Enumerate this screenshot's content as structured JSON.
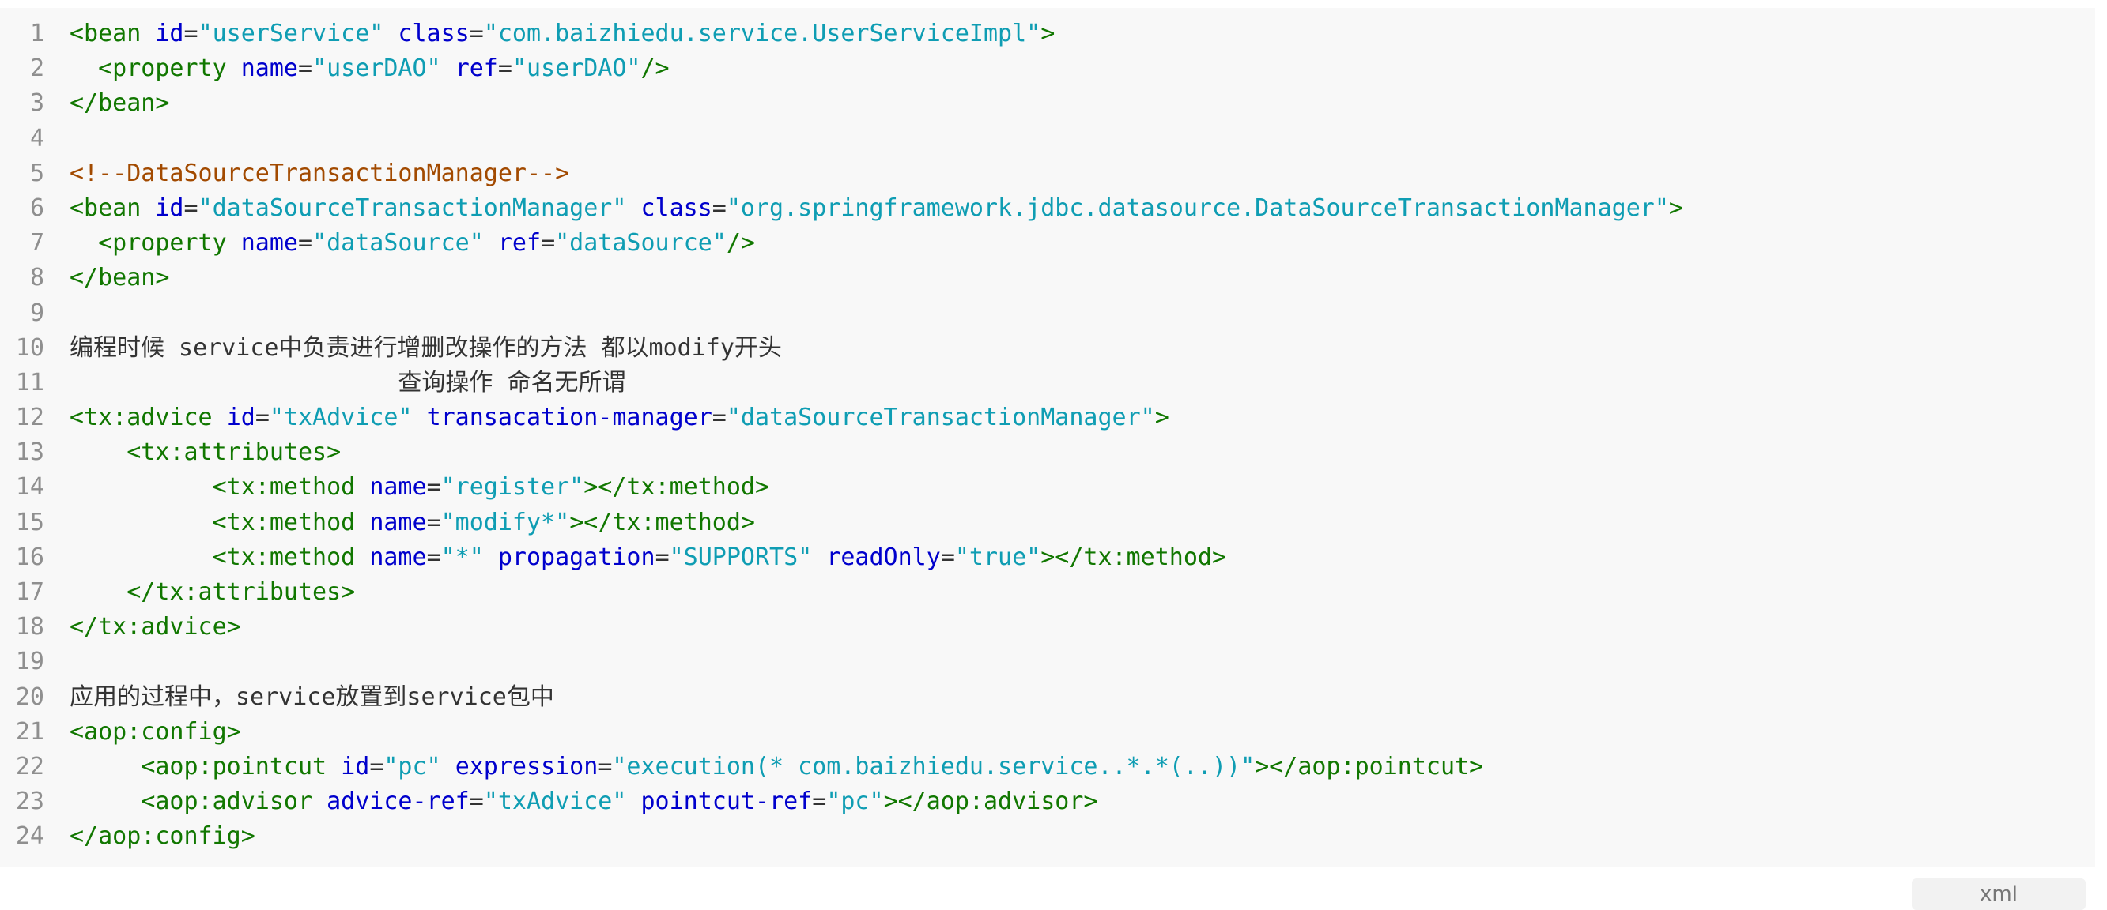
{
  "code_block": {
    "language": "xml",
    "colors": {
      "background": "#f8f8f8",
      "line_number": "#8f8f8f",
      "tag": "#117700",
      "attribute": "#0000cc",
      "string": "#0f9db3",
      "comment": "#a24a00",
      "text": "#333333"
    },
    "lines": [
      [
        {
          "t": "tag",
          "v": "<bean "
        },
        {
          "t": "attr",
          "v": "id"
        },
        {
          "t": "txt",
          "v": "="
        },
        {
          "t": "str",
          "v": "\"userService\""
        },
        {
          "t": "txt",
          "v": " "
        },
        {
          "t": "attr",
          "v": "class"
        },
        {
          "t": "txt",
          "v": "="
        },
        {
          "t": "str",
          "v": "\"com.baizhiedu.service.UserServiceImpl\""
        },
        {
          "t": "tag",
          "v": ">"
        }
      ],
      [
        {
          "t": "txt",
          "v": "  "
        },
        {
          "t": "tag",
          "v": "<property "
        },
        {
          "t": "attr",
          "v": "name"
        },
        {
          "t": "txt",
          "v": "="
        },
        {
          "t": "str",
          "v": "\"userDAO\""
        },
        {
          "t": "txt",
          "v": " "
        },
        {
          "t": "attr",
          "v": "ref"
        },
        {
          "t": "txt",
          "v": "="
        },
        {
          "t": "str",
          "v": "\"userDAO\""
        },
        {
          "t": "tag",
          "v": "/>"
        }
      ],
      [
        {
          "t": "tag",
          "v": "</bean>"
        }
      ],
      [],
      [
        {
          "t": "cmt",
          "v": "<!--DataSourceTransactionManager-->"
        }
      ],
      [
        {
          "t": "tag",
          "v": "<bean "
        },
        {
          "t": "attr",
          "v": "id"
        },
        {
          "t": "txt",
          "v": "="
        },
        {
          "t": "str",
          "v": "\"dataSourceTransactionManager\""
        },
        {
          "t": "txt",
          "v": " "
        },
        {
          "t": "attr",
          "v": "class"
        },
        {
          "t": "txt",
          "v": "="
        },
        {
          "t": "str",
          "v": "\"org.springframework.jdbc.datasource.DataSourceTransactionManager\""
        },
        {
          "t": "tag",
          "v": ">"
        }
      ],
      [
        {
          "t": "txt",
          "v": "  "
        },
        {
          "t": "tag",
          "v": "<property "
        },
        {
          "t": "attr",
          "v": "name"
        },
        {
          "t": "txt",
          "v": "="
        },
        {
          "t": "str",
          "v": "\"dataSource\""
        },
        {
          "t": "txt",
          "v": " "
        },
        {
          "t": "attr",
          "v": "ref"
        },
        {
          "t": "txt",
          "v": "="
        },
        {
          "t": "str",
          "v": "\"dataSource\""
        },
        {
          "t": "tag",
          "v": "/>"
        }
      ],
      [
        {
          "t": "tag",
          "v": "</bean>"
        }
      ],
      [],
      [
        {
          "t": "txt",
          "v": "编程时候 service中负责进行增删改操作的方法 都以modify开头"
        }
      ],
      [
        {
          "t": "txt",
          "v": "                       查询操作 命名无所谓"
        }
      ],
      [
        {
          "t": "tag",
          "v": "<tx:advice "
        },
        {
          "t": "attr",
          "v": "id"
        },
        {
          "t": "txt",
          "v": "="
        },
        {
          "t": "str",
          "v": "\"txAdvice\""
        },
        {
          "t": "txt",
          "v": " "
        },
        {
          "t": "attr",
          "v": "transacation-manager"
        },
        {
          "t": "txt",
          "v": "="
        },
        {
          "t": "str",
          "v": "\"dataSourceTransactionManager\""
        },
        {
          "t": "tag",
          "v": ">"
        }
      ],
      [
        {
          "t": "txt",
          "v": "    "
        },
        {
          "t": "tag",
          "v": "<tx:attributes>"
        }
      ],
      [
        {
          "t": "txt",
          "v": "          "
        },
        {
          "t": "tag",
          "v": "<tx:method "
        },
        {
          "t": "attr",
          "v": "name"
        },
        {
          "t": "txt",
          "v": "="
        },
        {
          "t": "str",
          "v": "\"register\""
        },
        {
          "t": "tag",
          "v": "></tx:method>"
        }
      ],
      [
        {
          "t": "txt",
          "v": "          "
        },
        {
          "t": "tag",
          "v": "<tx:method "
        },
        {
          "t": "attr",
          "v": "name"
        },
        {
          "t": "txt",
          "v": "="
        },
        {
          "t": "str",
          "v": "\"modify*\""
        },
        {
          "t": "tag",
          "v": "></tx:method>"
        }
      ],
      [
        {
          "t": "txt",
          "v": "          "
        },
        {
          "t": "tag",
          "v": "<tx:method "
        },
        {
          "t": "attr",
          "v": "name"
        },
        {
          "t": "txt",
          "v": "="
        },
        {
          "t": "str",
          "v": "\"*\""
        },
        {
          "t": "txt",
          "v": " "
        },
        {
          "t": "attr",
          "v": "propagation"
        },
        {
          "t": "txt",
          "v": "="
        },
        {
          "t": "str",
          "v": "\"SUPPORTS\""
        },
        {
          "t": "txt",
          "v": " "
        },
        {
          "t": "attr",
          "v": "readOnly"
        },
        {
          "t": "txt",
          "v": "="
        },
        {
          "t": "str",
          "v": "\"true\""
        },
        {
          "t": "tag",
          "v": "></tx:method>"
        }
      ],
      [
        {
          "t": "txt",
          "v": "    "
        },
        {
          "t": "tag",
          "v": "</tx:attributes>"
        }
      ],
      [
        {
          "t": "tag",
          "v": "</tx:advice>"
        }
      ],
      [],
      [
        {
          "t": "txt",
          "v": "应用的过程中，service放置到service包中"
        }
      ],
      [
        {
          "t": "tag",
          "v": "<aop:config>"
        }
      ],
      [
        {
          "t": "txt",
          "v": "     "
        },
        {
          "t": "tag",
          "v": "<aop:pointcut "
        },
        {
          "t": "attr",
          "v": "id"
        },
        {
          "t": "txt",
          "v": "="
        },
        {
          "t": "str",
          "v": "\"pc\""
        },
        {
          "t": "txt",
          "v": " "
        },
        {
          "t": "attr",
          "v": "expression"
        },
        {
          "t": "txt",
          "v": "="
        },
        {
          "t": "str",
          "v": "\"execution(* com.baizhiedu.service..*.*(..))\""
        },
        {
          "t": "tag",
          "v": "></aop:pointcut>"
        }
      ],
      [
        {
          "t": "txt",
          "v": "     "
        },
        {
          "t": "tag",
          "v": "<aop:advisor "
        },
        {
          "t": "attr",
          "v": "advice-ref"
        },
        {
          "t": "txt",
          "v": "="
        },
        {
          "t": "str",
          "v": "\"txAdvice\""
        },
        {
          "t": "txt",
          "v": " "
        },
        {
          "t": "attr",
          "v": "pointcut-ref"
        },
        {
          "t": "txt",
          "v": "="
        },
        {
          "t": "str",
          "v": "\"pc\""
        },
        {
          "t": "tag",
          "v": "></aop:advisor>"
        }
      ],
      [
        {
          "t": "tag",
          "v": "</aop:config>"
        }
      ]
    ]
  }
}
